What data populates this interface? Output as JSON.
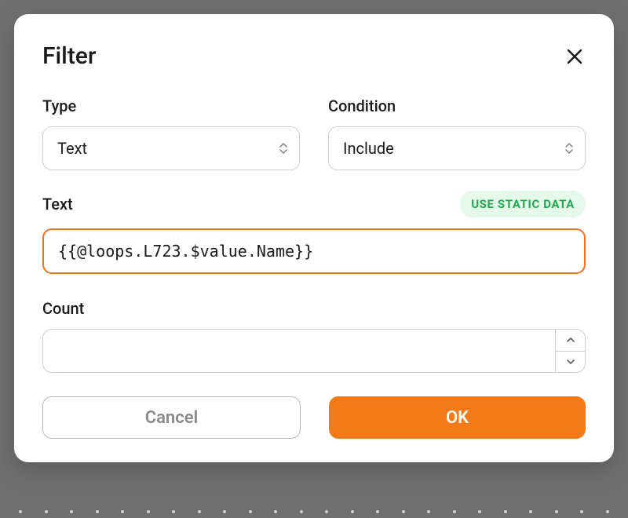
{
  "modal": {
    "title": "Filter",
    "type": {
      "label": "Type",
      "value": "Text"
    },
    "condition": {
      "label": "Condition",
      "value": "Include"
    },
    "text": {
      "label": "Text",
      "badge": "USE STATIC DATA",
      "value": "{{@loops.L723.$value.Name}}"
    },
    "count": {
      "label": "Count",
      "value": ""
    },
    "buttons": {
      "cancel": "Cancel",
      "ok": "OK"
    }
  }
}
